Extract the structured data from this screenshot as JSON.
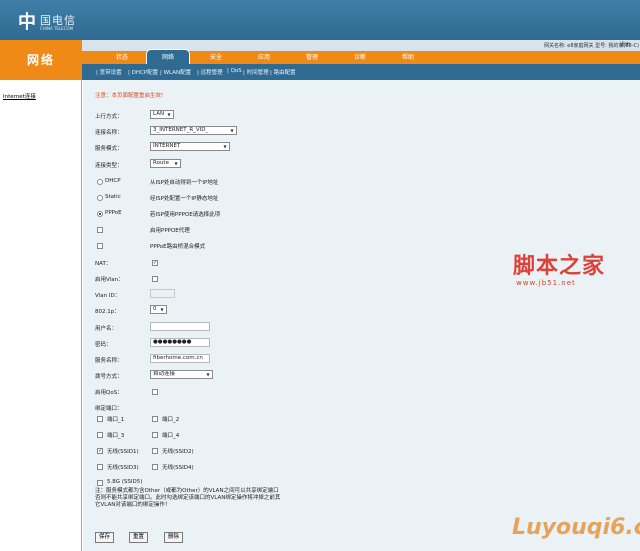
{
  "header": {
    "logo_mark": "中",
    "logo_text": "国电信",
    "logo_sub": "CHINA TELECOM",
    "model_text": "网关名称: e8家庭网关 型号: 我的家(E8-C)",
    "exit_label": "退出"
  },
  "brand": {
    "label": "网络"
  },
  "nav": {
    "tabs": [
      {
        "label": "状态"
      },
      {
        "label": "网络"
      },
      {
        "label": "安全"
      },
      {
        "label": "应用"
      },
      {
        "label": "管理"
      },
      {
        "label": "诊断"
      },
      {
        "label": "帮助"
      }
    ]
  },
  "subnav": {
    "items": [
      {
        "label": "| 宽带设置"
      },
      {
        "label": "| DHCP配置"
      },
      {
        "label": "| WLAN配置"
      },
      {
        "label": "| 远程管理"
      },
      {
        "label": "| QoS"
      },
      {
        "label": "| 时间管理"
      },
      {
        "label": "| 路由配置"
      }
    ]
  },
  "sidebar": {
    "item": "Internet连接"
  },
  "form": {
    "notice": "注意：本页面配置重启生效!",
    "uplink_label": "上行方式：",
    "uplink_value": "LAN",
    "conn_name_label": "连接名称：",
    "conn_name_value": "3_INTERNET_R_VID_",
    "service_mode_label": "服务模式：",
    "service_mode_value": "INTERNET",
    "conn_type_label": "连接类型：",
    "conn_type_value": "Route",
    "dhcp_label": "DHCP",
    "dhcp_desc": "从ISP处自动得到一个IP地址",
    "static_label": "Static",
    "static_desc": "经ISP处配置一个IP静态地址",
    "pppoe_label": "PPPoE",
    "pppoe_desc": "若ISP使用PPPOE请选择此项",
    "pppoe_proxy_label": "启用PPPOE代理",
    "pppoe_bridge_label": "PPPoE路由桥混合模式",
    "nat_label": "NAT：",
    "vlan_enable_label": "启用Vlan：",
    "vlan_id_label": "Vlan ID：",
    "dot1p_label": "802.1p：",
    "dot1p_value": "0",
    "username_label": "用户名：",
    "password_label": "密码：",
    "password_value": "●●●●●●●●",
    "service_name_label": "服务名称：",
    "service_name_value": "fiberhome.com.cn",
    "dial_label": "拨号方式：",
    "dial_value": "自动连接",
    "qos_label": "启用QoS：",
    "bind_label": "绑定端口：",
    "port1": "端口_1",
    "port2": "端口_2",
    "port3": "端口_3",
    "port4": "端口_4",
    "ssid1": "无线(SSID1)",
    "ssid2": "无线(SSID2)",
    "ssid3": "无线(SSID3)",
    "ssid4": "无线(SSID4)",
    "ssid5": "5.8G (SSID5)",
    "note_line1": "注：服务模式都为含Other（或都为Other）的VLAN之间可以共享绑定端口",
    "note_line2": "否则不能共享绑定端口。此时勾选绑定该端口的VLAN绑定操作将冲掉之前其",
    "note_line3": "它VLAN对该端口的绑定操作！"
  },
  "buttons": {
    "save": "保存",
    "reset": "重置",
    "delete": "删除"
  },
  "watermark": {
    "text1": "脚本之家",
    "text1_sub": "www.jb51.net",
    "text2": "Luyouqi6.cn"
  }
}
